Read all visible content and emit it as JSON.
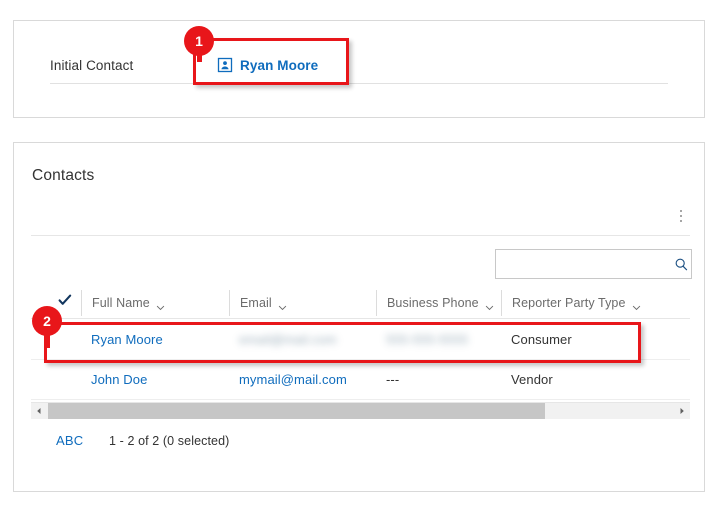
{
  "initial_contact_card": {
    "label": "Initial Contact",
    "value": {
      "icon": "contact-card-icon",
      "text": "Ryan Moore"
    }
  },
  "contacts_card": {
    "title": "Contacts",
    "overflow_menu": "more-commands-icon",
    "search": {
      "placeholder": "",
      "value": "",
      "icon": "search-icon"
    },
    "grid": {
      "select_all_icon": "checkmark-icon",
      "columns": [
        {
          "label": "Full Name",
          "sort_icon": "chevron-down-icon"
        },
        {
          "label": "Email",
          "sort_icon": "chevron-down-icon"
        },
        {
          "label": "Business Phone",
          "sort_icon": "chevron-down-icon"
        },
        {
          "label": "Reporter Party Type",
          "sort_icon": "chevron-down-icon"
        }
      ],
      "rows": [
        {
          "full_name": "Ryan Moore",
          "email": "email@mail.com",
          "business_phone": "555-555-5555",
          "reporter_party_type": "Consumer"
        },
        {
          "full_name": "John Doe",
          "email": "mymail@mail.com",
          "business_phone": "---",
          "reporter_party_type": "Vendor"
        }
      ]
    },
    "scrollbar": {
      "left_arrow": "caret-left-icon",
      "right_arrow": "caret-right-icon"
    },
    "status": {
      "jump_bar": "ABC",
      "record_count": "1 - 2 of 2 (0 selected)"
    }
  },
  "annotations": [
    {
      "number": "1"
    },
    {
      "number": "2"
    }
  ],
  "colors": {
    "link": "#0f6cbd",
    "annotation_red": "#e8161a",
    "border": "#d9d9d9"
  }
}
